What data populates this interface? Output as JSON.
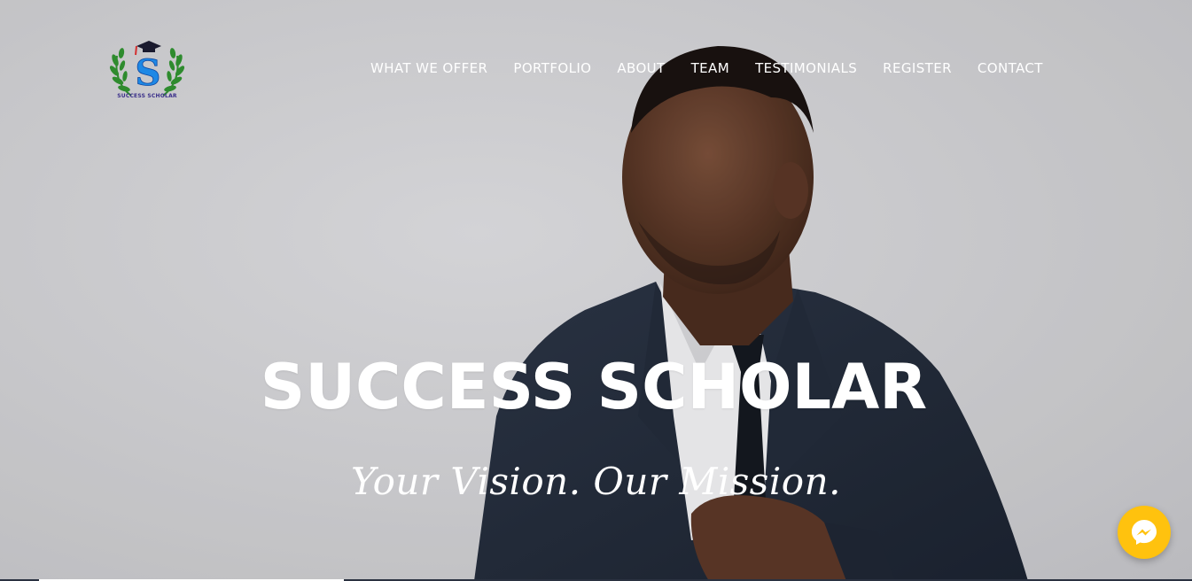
{
  "brand": {
    "logo_caption": "SUCCESS SCHOLAR",
    "logo_monogram": "S",
    "colors": {
      "laurel": "#2e8b2e",
      "monogram": "#1e88e5",
      "cap": "#1a1a2e",
      "tassel": "#d32f2f"
    }
  },
  "nav": {
    "items": [
      {
        "label": "WHAT WE OFFER"
      },
      {
        "label": "PORTFOLIO"
      },
      {
        "label": "ABOUT"
      },
      {
        "label": "TEAM"
      },
      {
        "label": "TESTIMONIALS"
      },
      {
        "label": "REGISTER"
      },
      {
        "label": "CONTACT"
      }
    ]
  },
  "hero": {
    "title": "SUCCESS SCHOLAR",
    "tagline": "Your Vision. Our Mission."
  },
  "chat_widget": {
    "icon": "messenger-icon",
    "color": "#ffc20e"
  }
}
